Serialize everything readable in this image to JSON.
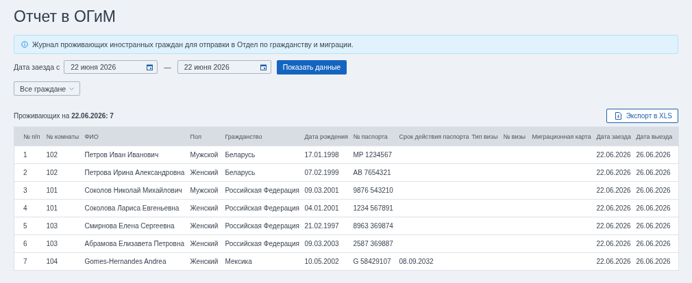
{
  "page_title": "Отчет в ОГиМ",
  "info_banner": "Журнал проживающих иностранных граждан для отправки в Отдел по гражданству и миграции.",
  "filters": {
    "date_label": "Дата заезда с",
    "date_from": "22 июня 2026",
    "separator": "—",
    "date_to": "22 июня 2026",
    "submit_button": "Показать данные",
    "citizens_dropdown": "Все граждане"
  },
  "summary": {
    "label": "Проживающих на ",
    "date": "22.06.2026",
    "count": ": 7"
  },
  "export_button": "Экспорт в XLS",
  "table": {
    "columns": [
      "№ п/п",
      "№ комнаты",
      "ФИО",
      "Пол",
      "Гражданство",
      "Дата рождения",
      "№ паспорта",
      "Срок действия паспорта",
      "Тип визы",
      "№ визы",
      "Миграционная карта",
      "Дата заезда",
      "Дата выезда"
    ],
    "rows": [
      [
        "1",
        "102",
        "Петров Иван Иванович",
        "Мужской",
        "Беларусь",
        "17.01.1998",
        "MP 1234567",
        null,
        null,
        null,
        null,
        "22.06.2026",
        "26.06.2026"
      ],
      [
        "2",
        "102",
        "Петрова Ирина Александровна",
        "Женский",
        "Беларусь",
        "07.02.1999",
        "AB 7654321",
        null,
        null,
        null,
        null,
        "22.06.2026",
        "26.06.2026"
      ],
      [
        "3",
        "101",
        "Соколов Николай Михайлович",
        "Мужской",
        "Российская Федерация",
        "09.03.2001",
        "9876 543210",
        null,
        null,
        null,
        null,
        "22.06.2026",
        "26.06.2026"
      ],
      [
        "4",
        "101",
        "Соколова Лариса Евгеньевна",
        "Женский",
        "Российская Федерация",
        "04.01.2001",
        "1234 567891",
        null,
        null,
        null,
        null,
        "22.06.2026",
        "26.06.2026"
      ],
      [
        "5",
        "103",
        "Смирнова Елена Сергеевна",
        "Женский",
        "Российская Федерация",
        "21.02.1997",
        "8963 369874",
        null,
        null,
        null,
        null,
        "22.06.2026",
        "26.06.2026"
      ],
      [
        "6",
        "103",
        "Абрамова Елизавета Петровна",
        "Женский",
        "Российская Федерация",
        "09.03.2003",
        "2587 369887",
        null,
        null,
        null,
        null,
        "22.06.2026",
        "26.06.2026"
      ],
      [
        "7",
        "104",
        "Gomes-Hernandes Andrea",
        "Женский",
        "Мексика",
        "10.05.2002",
        "G 58429107",
        "08.09.2032",
        null,
        null,
        null,
        "22.06.2026",
        "26.06.2026"
      ]
    ]
  }
}
